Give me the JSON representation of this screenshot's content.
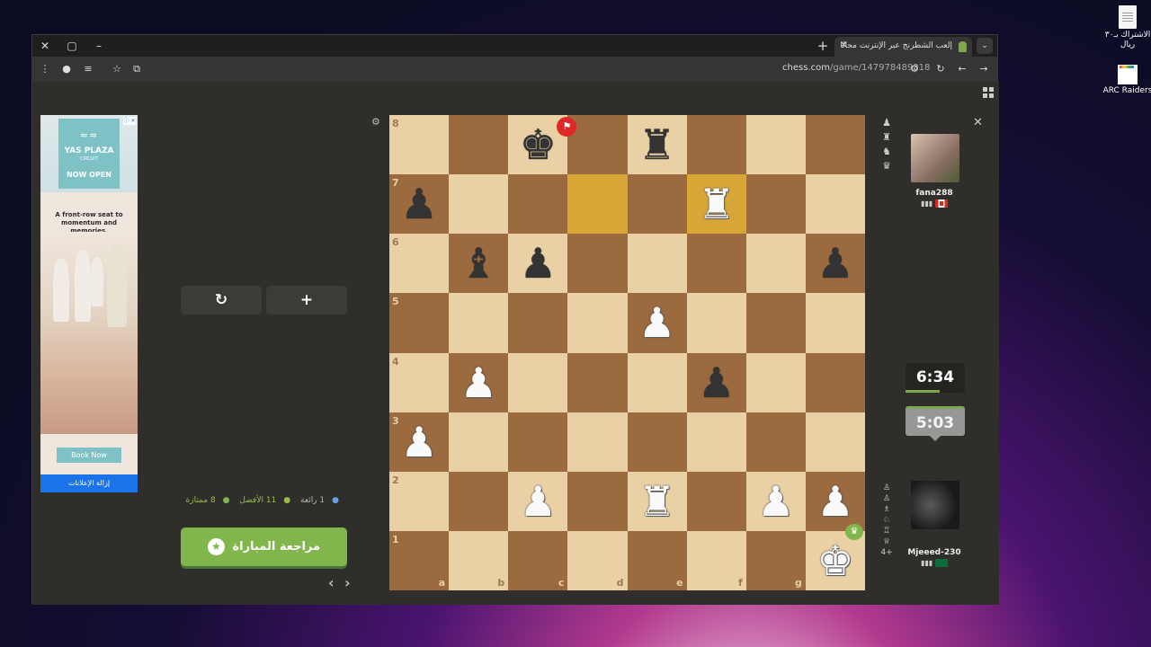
{
  "desktop": {
    "icons": [
      {
        "label": "الاشتراك بـ٣٠ ريال"
      },
      {
        "label": "ARC Raiders",
        "logo_text": "ARC Raiders"
      }
    ]
  },
  "browser": {
    "tab_title": "إلعب الشطرنج عبر الإنترنت مجانًا",
    "url_host": "chess.com",
    "url_path": "/game/147978489318"
  },
  "ad": {
    "brand_mark": "≈≈",
    "brand_name": "YAS PLAZA",
    "brand_sub": "CIRCUIT",
    "now_open": "NOW OPEN",
    "tagline": "A front-row seat to momentum and memories.",
    "cta": "Book Now",
    "remove_ads": "إزالة الإعلانات",
    "adchoices": "ⓘ ✕"
  },
  "controls": {
    "rematch_icon": "↻",
    "new_game_icon": "+",
    "stats": {
      "brilliant": "1 رائعة",
      "best": "11 الأفضل",
      "excellent": "8 ممتازة"
    },
    "review_label": "مراجعة المباراة",
    "review_icon": "★",
    "prev": "‹",
    "next": "›"
  },
  "board": {
    "ranks": [
      "8",
      "7",
      "6",
      "5",
      "4",
      "3",
      "2",
      "1"
    ],
    "files": [
      "a",
      "b",
      "c",
      "d",
      "e",
      "f",
      "g",
      "h"
    ],
    "position": [
      [
        "",
        "",
        "bk",
        "",
        "br",
        "",
        "",
        ""
      ],
      [
        "bp",
        "",
        "",
        "",
        "",
        "wr",
        "",
        ""
      ],
      [
        "",
        "bb",
        "bp",
        "",
        "",
        "",
        "",
        "bp"
      ],
      [
        "",
        "",
        "",
        "",
        "wp",
        "",
        "",
        ""
      ],
      [
        "",
        "wp",
        "",
        "",
        "",
        "bp",
        "",
        ""
      ],
      [
        "wp",
        "",
        "",
        "",
        "",
        "",
        "",
        ""
      ],
      [
        "",
        "",
        "wp",
        "",
        "wr",
        "",
        "wp",
        "wp"
      ],
      [
        "",
        "",
        "",
        "",
        "",
        "",
        "",
        "wk"
      ]
    ],
    "highlights": [
      "d7",
      "f7"
    ],
    "file_labels_shown": [
      "a",
      "b",
      "c",
      "d",
      "e",
      "f",
      "g"
    ]
  },
  "players": {
    "top": {
      "name": "fana288",
      "rating_icon": "▮▮▮",
      "country": "CA",
      "clock": "6:34",
      "clock_fraction": 0.58
    },
    "bottom": {
      "name": "Mjeeed-230",
      "rating_icon": "▮▮▮",
      "country": "SA",
      "clock": "5:03",
      "captured_more": "4+"
    }
  },
  "colors": {
    "light_square": "#e9d1a5",
    "dark_square": "#9b6a3f",
    "highlight": "#d7a637",
    "accent_green": "#81b64c"
  }
}
